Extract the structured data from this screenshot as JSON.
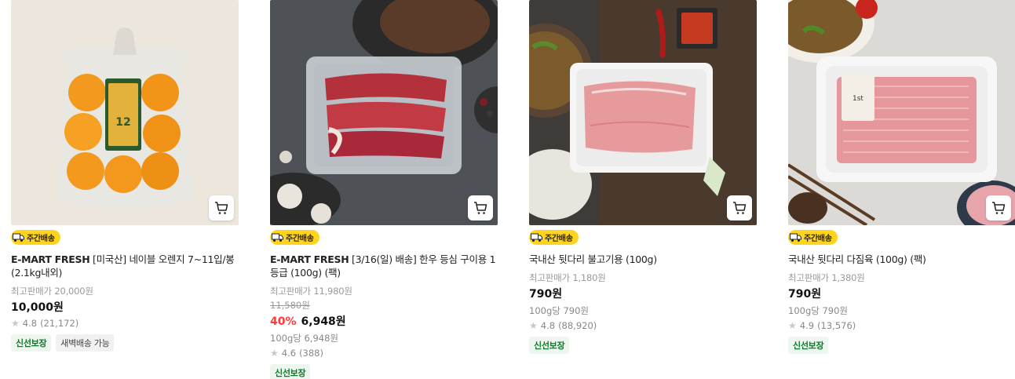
{
  "products": [
    {
      "badge": "주간배송",
      "brand": "E-MART FRESH",
      "name": " [미국산] 네이블 오렌지 7~11입/봉 (2.1kg내외)",
      "max_price_label": "최고판매가 20,000원",
      "price": "10,000원",
      "rating": "4.8",
      "reviews": "(21,172)",
      "tags": [
        "신선보장",
        "새벽배송 가능"
      ]
    },
    {
      "badge": "주간배송",
      "brand": "E-MART FRESH",
      "name": " [3/16(일) 배송] 한우 등심 구이용 1등급 (100g) (팩)",
      "max_price_label": "최고판매가 11,980원",
      "original_price": "11,580원",
      "discount": "40%",
      "price": "6,948원",
      "unit_price": "100g당 6,948원",
      "rating": "4.6",
      "reviews": "(388)",
      "tags": [
        "신선보장"
      ]
    },
    {
      "badge": "주간배송",
      "brand": "",
      "name": "국내산 뒷다리 불고기용 (100g)",
      "max_price_label": "최고판매가 1,180원",
      "price": "790원",
      "unit_price": "100g당 790원",
      "rating": "4.8",
      "reviews": "(88,920)",
      "tags": [
        "신선보장"
      ]
    },
    {
      "badge": "주간배송",
      "brand": "",
      "name": "국내산 뒷다리 다짐육 (100g) (팩)",
      "max_price_label": "최고판매가 1,380원",
      "price": "790원",
      "unit_price": "100g당 790원",
      "rating": "4.9",
      "reviews": "(13,576)",
      "tags": [
        "신선보장"
      ]
    }
  ],
  "icons": {
    "cart": "cart-icon",
    "truck": "truck-icon",
    "star": "star-icon"
  },
  "colors": {
    "badge_bg": "#ffd41e",
    "discount": "#ff3b3b",
    "tag_green_text": "#0e7a2a"
  }
}
